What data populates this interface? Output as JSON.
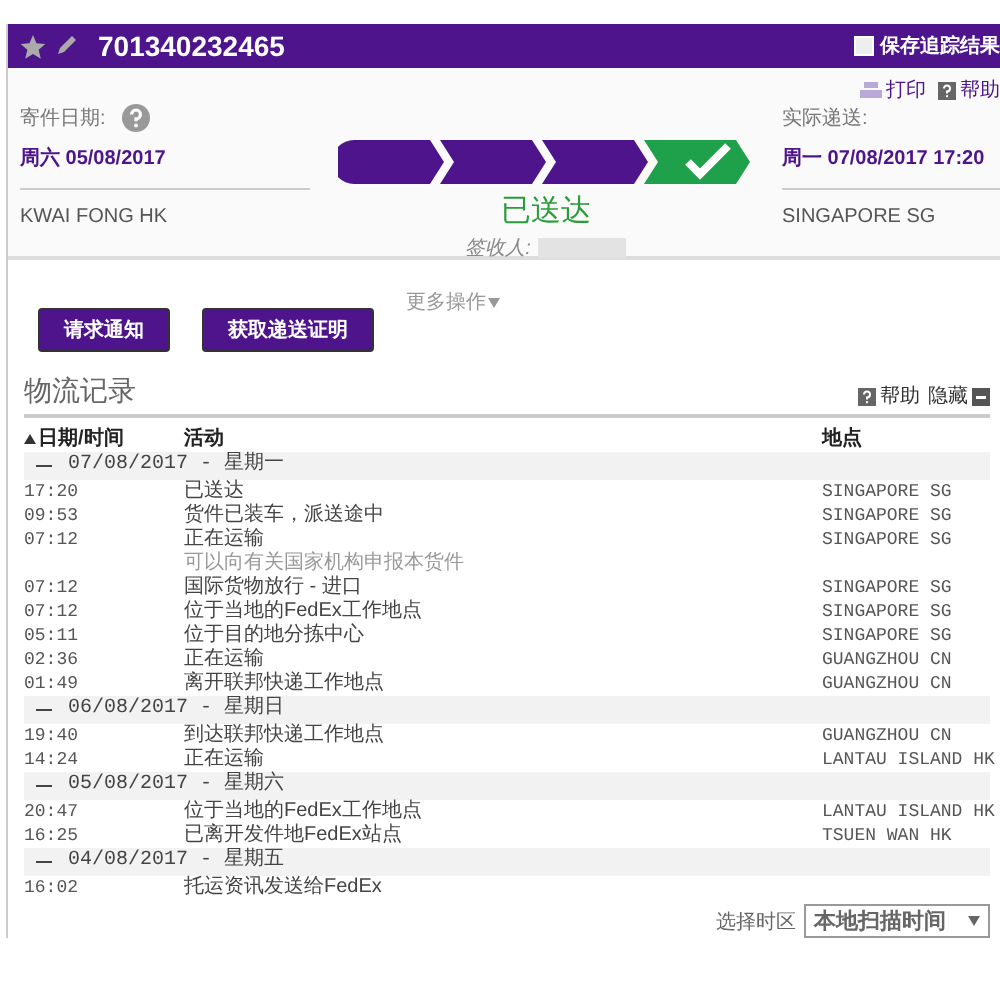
{
  "header": {
    "tracking_number": "701340232465",
    "save_results": {
      "label": "保存追踪结果",
      "checked": false
    }
  },
  "links": [
    {
      "kind": "print",
      "label": "打印"
    },
    {
      "kind": "help",
      "label": "帮助"
    }
  ],
  "ship": {
    "label": "寄件日期:",
    "date": "周六 05/08/2017",
    "location": "KWAI FONG HK"
  },
  "delivery": {
    "label": "实际递送:",
    "date": "周一 07/08/2017 17:20",
    "location": "SINGAPORE SG"
  },
  "progress": {
    "steps": [
      {
        "kind": "transit"
      },
      {
        "kind": "transit"
      },
      {
        "kind": "transit"
      },
      {
        "kind": "delivered"
      }
    ],
    "status": "已送达",
    "signed_by_label": "签收人:"
  },
  "actions": {
    "buttons": [
      "请求通知",
      "获取递送证明"
    ],
    "more": "更多操作"
  },
  "history": {
    "title": "物流记录",
    "help": "帮助",
    "hide": "隐藏",
    "columns": [
      "日期/时间",
      "活动",
      "地点"
    ],
    "groups": [
      {
        "date": "07/08/2017 - 星期一",
        "expanded": true,
        "rows": [
          {
            "time": "17:20",
            "activity": "已送达",
            "location": "SINGAPORE SG"
          },
          {
            "time": "09:53",
            "activity": "货件已装车，派送途中",
            "location": "SINGAPORE SG"
          },
          {
            "time": "07:12",
            "activity": "正在运输",
            "note": "可以向有关国家机构申报本货件",
            "location": "SINGAPORE SG"
          },
          {
            "time": "07:12",
            "activity": "国际货物放行 - 进口",
            "location": "SINGAPORE SG"
          },
          {
            "time": "07:12",
            "activity": "位于当地的FedEx工作地点",
            "location": "SINGAPORE SG"
          },
          {
            "time": "05:11",
            "activity": "位于目的地分拣中心",
            "location": "SINGAPORE SG"
          },
          {
            "time": "02:36",
            "activity": "正在运输",
            "location": "GUANGZHOU CN"
          },
          {
            "time": "01:49",
            "activity": "离开联邦快递工作地点",
            "location": "GUANGZHOU CN"
          }
        ]
      },
      {
        "date": "06/08/2017 - 星期日",
        "expanded": true,
        "rows": [
          {
            "time": "19:40",
            "activity": "到达联邦快递工作地点",
            "location": "GUANGZHOU CN"
          },
          {
            "time": "14:24",
            "activity": "正在运输",
            "location": "LANTAU ISLAND HK"
          }
        ]
      },
      {
        "date": "05/08/2017 - 星期六",
        "expanded": true,
        "rows": [
          {
            "time": "20:47",
            "activity": "位于当地的FedEx工作地点",
            "location": "LANTAU ISLAND HK"
          },
          {
            "time": "16:25",
            "activity": "已离开发件地FedEx站点",
            "location": "TSUEN WAN HK"
          }
        ]
      },
      {
        "date": "04/08/2017 - 星期五",
        "expanded": true,
        "rows": [
          {
            "time": "16:02",
            "activity": "托运资讯发送给FedEx",
            "location": ""
          }
        ]
      }
    ],
    "timezone": {
      "label": "选择时区",
      "value": "本地扫描时间"
    }
  }
}
